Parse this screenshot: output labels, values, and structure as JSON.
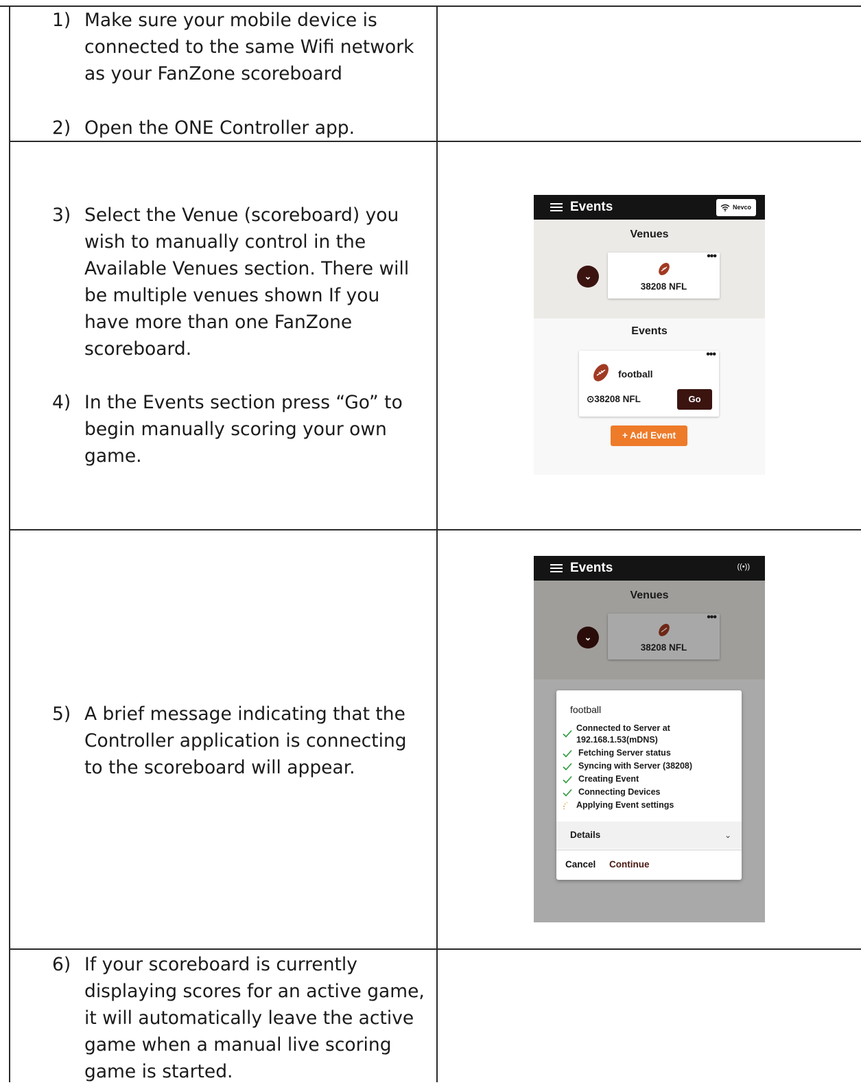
{
  "steps": [
    {
      "num": "1)",
      "text": "Make sure your mobile device is connected to the same Wifi network as your FanZone scoreboard"
    },
    {
      "num": "2)",
      "text": "Open the ONE Controller app."
    },
    {
      "num": "3)",
      "text": "Select the Venue (scoreboard) you wish to manually control in the Available Venues section. There will be multiple venues shown If you have more than one FanZone scoreboard."
    },
    {
      "num": "4)",
      "text": "In the Events section press “Go” to begin manually scoring your own game."
    },
    {
      "num": "5)",
      "text": "A brief message indicating that the Controller application is connecting to the scoreboard will appear."
    },
    {
      "num": "6)",
      "text": "If your scoreboard is currently displaying scores for an active game, it will automatically leave the active game when a manual live scoring game is started."
    }
  ],
  "screen1": {
    "app_title": "Events",
    "wifi_label": "Nevco",
    "venues_heading": "Venues",
    "venue_name": "38208 NFL",
    "events_heading": "Events",
    "event_name": "football",
    "event_location": "⊙38208 NFL",
    "go_label": "Go",
    "add_event_label": "+ Add Event",
    "more_icon": "ellipsis-icon",
    "accent_color": "#ee7b2a",
    "brand_color": "#3b1410"
  },
  "screen2": {
    "app_title": "Events",
    "broadcast_label": "((•))",
    "venues_heading": "Venues",
    "venue_name": "38208 NFL",
    "dialog_title": "football",
    "status_items": [
      {
        "label": "Connected to Server at 192.168.1.53(mDNS)",
        "state": "done"
      },
      {
        "label": "Fetching Server status",
        "state": "done"
      },
      {
        "label": "Syncing with Server (38208)",
        "state": "done"
      },
      {
        "label": "Creating Event",
        "state": "done"
      },
      {
        "label": "Connecting Devices",
        "state": "done"
      },
      {
        "label": "Applying Event settings",
        "state": "loading"
      }
    ],
    "details_label": "Details",
    "cancel_label": "Cancel",
    "continue_label": "Continue"
  }
}
